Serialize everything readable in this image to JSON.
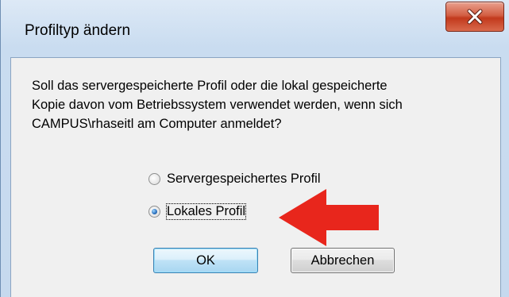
{
  "dialog": {
    "title": "Profiltyp ändern",
    "close_icon": "close-x-icon",
    "message_lines": [
      "Soll das servergespeicherte Profil oder die lokal gespeicherte",
      "Kopie davon vom Betriebssystem verwendet werden, wenn sich",
      "CAMPUS\\rhaseitl am Computer anmeldet?"
    ],
    "options": [
      {
        "label": "Servergespeichertes Profil",
        "checked": false
      },
      {
        "label": "Lokales Profil",
        "checked": true
      }
    ],
    "ok_label": "OK",
    "cancel_label": "Abbrechen"
  },
  "annotation": {
    "icon": "red-arrow-left-icon",
    "color": "#e8261c"
  },
  "colors": {
    "close_button": "#c8422a",
    "ok_button_border": "#3c7fb1",
    "content_bg": "#f0f0f0"
  }
}
